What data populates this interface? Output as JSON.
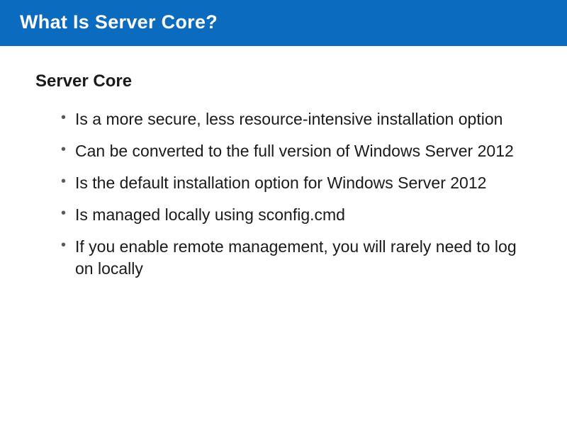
{
  "title": "What Is Server Core?",
  "subheading": "Server Core",
  "bullets": [
    "Is a more secure, less resource-intensive installation option",
    "Can be converted to the full version of Windows Server 2012",
    "Is the default installation option for Windows Server 2012",
    "Is managed locally using sconfig.cmd",
    "If you enable remote management, you will rarely need to log on locally"
  ]
}
